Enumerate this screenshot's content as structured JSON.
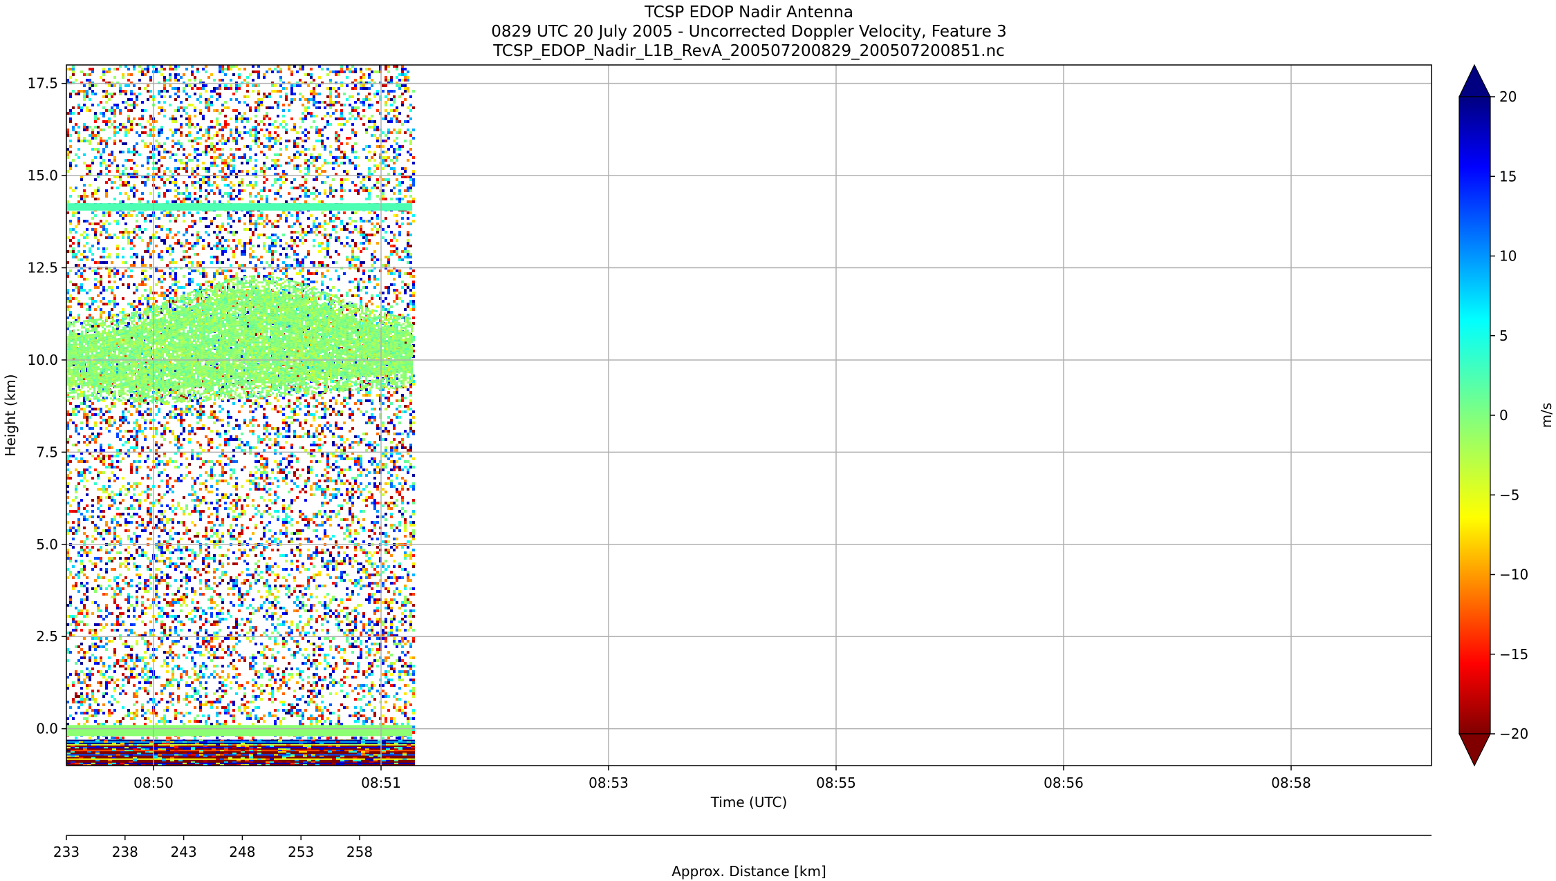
{
  "chart_data": {
    "type": "heatmap",
    "title_lines": [
      "TCSP EDOP Nadir Antenna",
      "0829 UTC 20 July 2005 - Uncorrected Doppler Velocity, Feature 3",
      "TCSP_EDOP_Nadir_L1B_RevA_200507200829_200507200851.nc"
    ],
    "xlabel": "Time (UTC)",
    "ylabel": "Height (km)",
    "x_ticks": [
      {
        "minutes": 50.0,
        "label": "08:50"
      },
      {
        "minutes": 51.0,
        "label": "08:51"
      },
      {
        "minutes": 53.0,
        "label": "08:53"
      },
      {
        "minutes": 55.0,
        "label": "08:55"
      },
      {
        "minutes": 56.0,
        "label": "08:56"
      },
      {
        "minutes": 58.0,
        "label": "08:58"
      }
    ],
    "x_range_minutes": [
      49.62,
      55.62
    ],
    "data_end_minutes": 51.14,
    "y_ticks": [
      "0.0",
      "2.5",
      "5.0",
      "7.5",
      "10.0",
      "12.5",
      "15.0",
      "17.5"
    ],
    "y_range": [
      -1.0,
      18.0
    ],
    "grid": true,
    "secondary_axis": {
      "label": "Approx. Distance [km]",
      "ticks": [
        "233",
        "238",
        "243",
        "248",
        "253",
        "258"
      ],
      "range": [
        233,
        283.3
      ]
    },
    "colorbar": {
      "label": "m/s",
      "ticks": [
        "20",
        "15",
        "10",
        "5",
        "0",
        "−5",
        "−10",
        "−15",
        "−20"
      ],
      "range": [
        -20,
        20
      ],
      "extend": "both",
      "colormap": "jet"
    },
    "features": [
      {
        "name": "surface",
        "height_km": [
          -1.0,
          -0.3
        ]
      },
      {
        "name": "near-surface band",
        "height_km": [
          -0.2,
          0.1
        ]
      },
      {
        "name": "thin layer",
        "height_km": [
          14.05,
          14.25
        ]
      },
      {
        "name": "cloud layer",
        "height_km_approx": [
          8.8,
          12.3
        ]
      }
    ]
  }
}
